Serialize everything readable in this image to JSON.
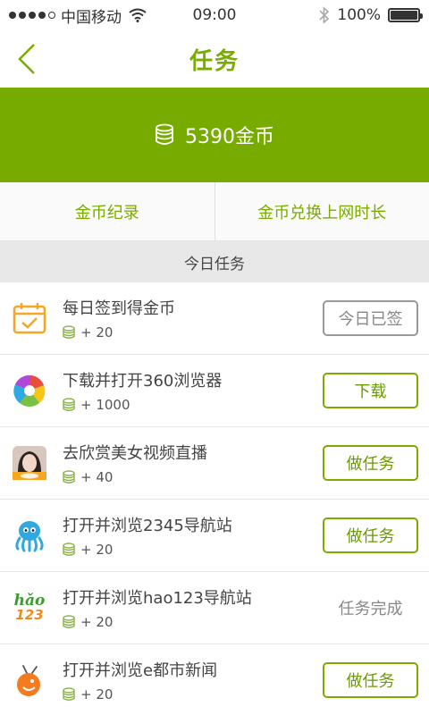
{
  "statusbar": {
    "carrier": "中国移动",
    "time": "09:00",
    "battery": "100%",
    "battery_level": 1.0
  },
  "nav": {
    "title": "任务"
  },
  "balance": {
    "text": "5390金币"
  },
  "links": {
    "coin_record": "金币纪录",
    "exchange": "金币兑换上网时长"
  },
  "section": {
    "title": "今日任务"
  },
  "tasks": [
    {
      "title": "每日签到得金币",
      "reward": "+ 20",
      "action": "今日已签",
      "icon": "calendar-check-icon"
    },
    {
      "title": "下载并打开360浏览器",
      "reward": "+ 1000",
      "action": "下载",
      "icon": "360-browser-icon"
    },
    {
      "title": "去欣赏美女视频直播",
      "reward": "+ 40",
      "action": "做任务",
      "icon": "live-video-app-icon"
    },
    {
      "title": "打开并浏览2345导航站",
      "reward": "+ 20",
      "action": "做任务",
      "icon": "octopus-2345-icon"
    },
    {
      "title": "打开并浏览hao123导航站",
      "reward": "+ 20",
      "action": "任务完成",
      "icon": "hao123-icon",
      "hao_text": "hǎo",
      "num_text": "123"
    },
    {
      "title": "打开并浏览e都市新闻",
      "reward": "+ 20",
      "action": "做任务",
      "icon": "e-city-news-icon"
    }
  ],
  "colors": {
    "accent": "#78ab00",
    "coin": "#8bb24a"
  }
}
